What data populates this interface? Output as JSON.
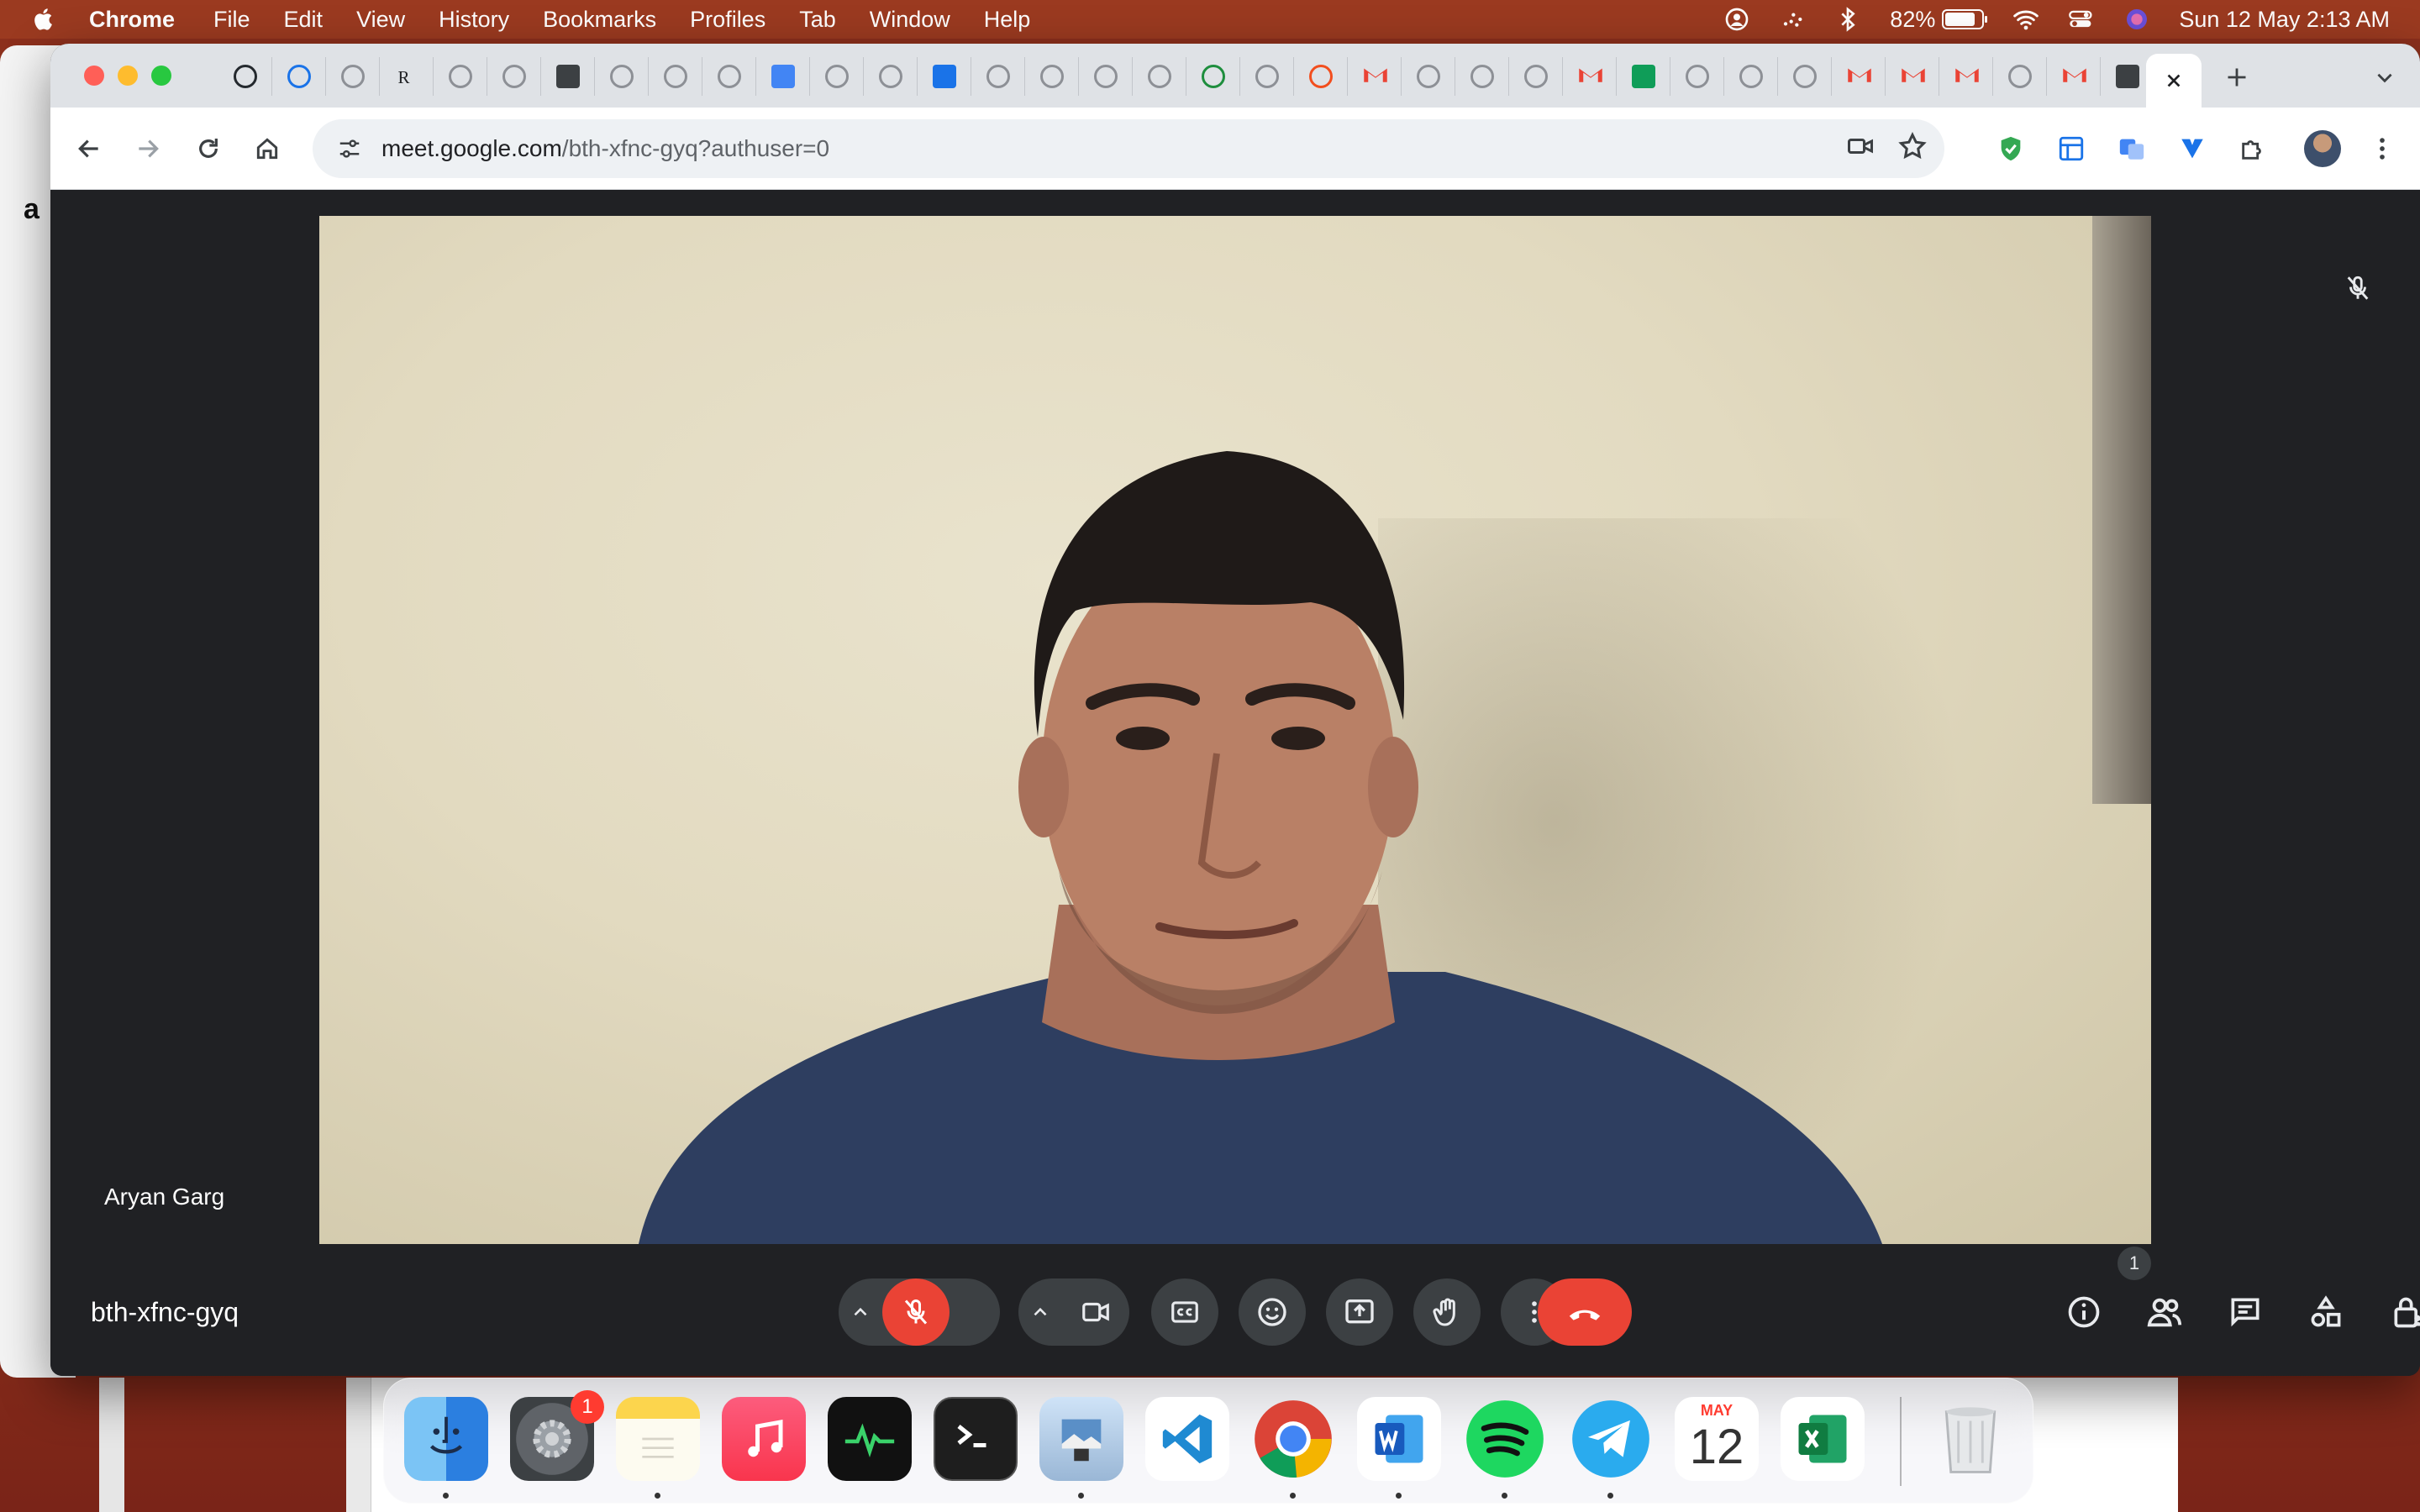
{
  "menubar": {
    "app_name": "Chrome",
    "items": [
      "File",
      "Edit",
      "View",
      "History",
      "Bookmarks",
      "Profiles",
      "Tab",
      "Window",
      "Help"
    ],
    "battery_percent": "82%",
    "battery_level": 0.82,
    "datetime": "Sun 12 May  2:13 AM"
  },
  "background": {
    "left_window_logo": "a"
  },
  "browser": {
    "url_host": "meet.google.com",
    "url_path": "/bth-xfnc-gyq?authuser=0",
    "tabs": [
      "github-icon",
      "vercel-icon",
      "site-icon",
      "rs-icon",
      "site-icon",
      "site-icon",
      "contact-icon",
      "site-icon",
      "site-icon",
      "site-icon",
      "docs-icon",
      "google-icon",
      "google-icon",
      "s-icon",
      "site-icon",
      "site-icon",
      "site-icon",
      "site-icon",
      "gear-icon",
      "site-icon",
      "figma-icon",
      "gmail-icon",
      "site-icon",
      "site-icon",
      "site-icon",
      "gmail-icon",
      "sheets-icon",
      "google-icon",
      "site-icon",
      "site-icon",
      "gmail-icon",
      "gmail-icon",
      "gmail-icon",
      "site-icon",
      "gmail-icon",
      "contact-icon"
    ]
  },
  "meet": {
    "participant_name": "Aryan Garg",
    "meeting_code": "bth-xfnc-gyq",
    "participant_count": "1"
  },
  "dock": {
    "apps": [
      "finder",
      "system-settings",
      "notes",
      "music",
      "activity-monitor",
      "terminal",
      "preview",
      "vscode",
      "chrome",
      "word",
      "spotify",
      "telegram",
      "calendar",
      "excel"
    ],
    "settings_badge": "1",
    "calendar_month": "MAY",
    "calendar_day": "12"
  },
  "colors": {
    "meet_bg": "#202124",
    "end_call": "#ea4335",
    "control_bg": "#3c4043"
  }
}
